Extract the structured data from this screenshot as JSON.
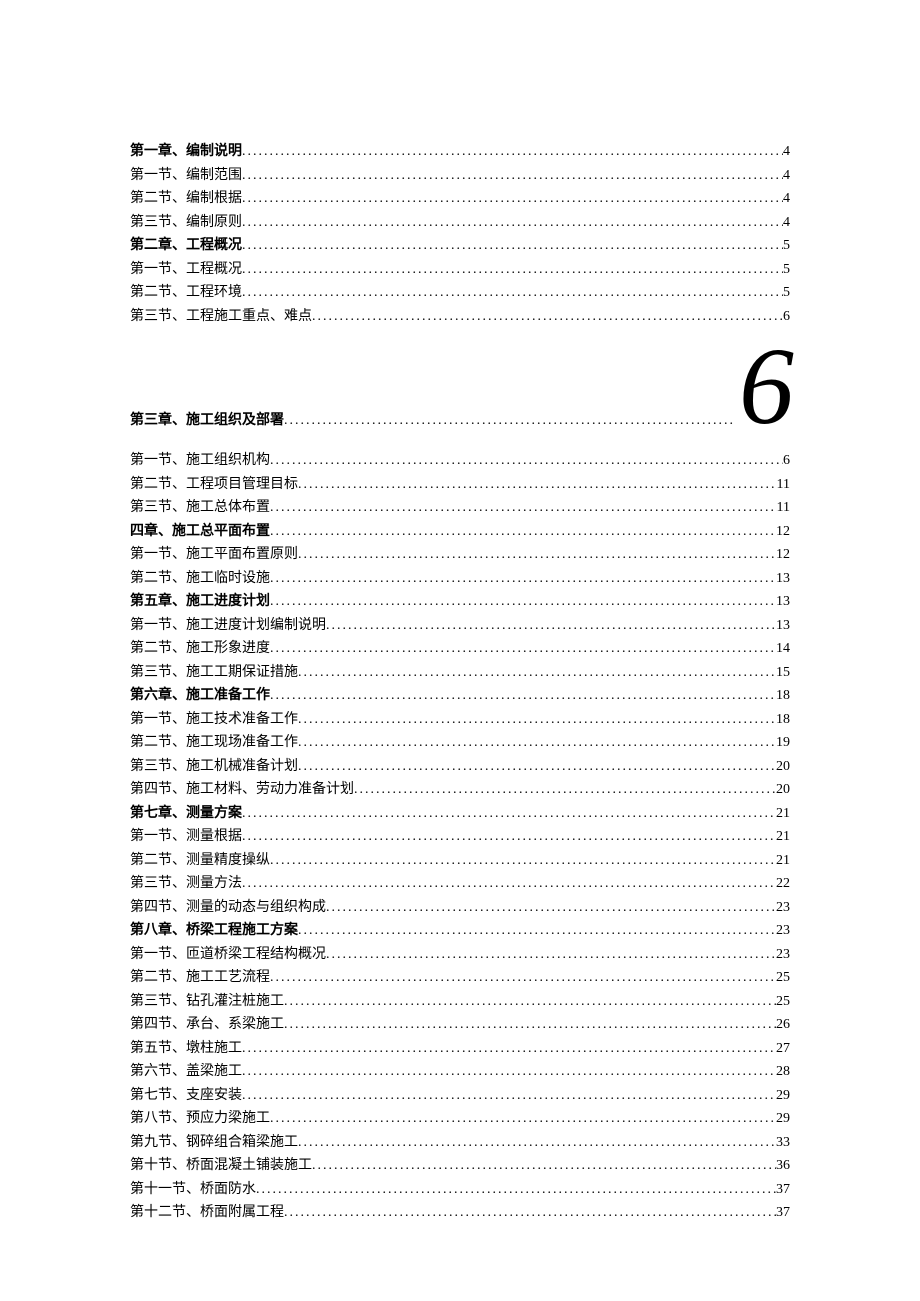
{
  "toc": [
    {
      "label": "第一章、编制说明",
      "page": "4",
      "bold": true
    },
    {
      "label": "第一节、编制范围",
      "page": "4",
      "bold": false
    },
    {
      "label": "第二节、编制根据",
      "page": "4",
      "bold": false
    },
    {
      "label": "第三节、编制原则",
      "page": "4",
      "bold": false
    },
    {
      "label": "第二章、工程概况",
      "page": "5",
      "bold": true
    },
    {
      "label": "第一节、工程概况",
      "page": "5",
      "bold": false
    },
    {
      "label": "第二节、工程环境",
      "page": "5",
      "bold": false
    },
    {
      "label": "第三节、工程施工重点、难点",
      "page": "6",
      "bold": false
    }
  ],
  "bigSixRow": {
    "label": "第三章、施工组织及部署",
    "page": "6"
  },
  "toc2": [
    {
      "label": "第一节、施工组织机构",
      "page": "6",
      "bold": false
    },
    {
      "label": "第二节、工程项目管理目标",
      "page": "11",
      "bold": false
    },
    {
      "label": "第三节、施工总体布置",
      "page": "11",
      "bold": false
    },
    {
      "label": "四章、施工总平面布置",
      "page": "12",
      "bold": true
    },
    {
      "label": "第一节、施工平面布置原则",
      "page": "12",
      "bold": false
    },
    {
      "label": "第二节、施工临时设施",
      "page": "13",
      "bold": false
    },
    {
      "label": "第五章、施工进度计划",
      "page": "13",
      "bold": true
    },
    {
      "label": "第一节、施工进度计划编制说明",
      "page": "13",
      "bold": false
    },
    {
      "label": "第二节、施工形象进度",
      "page": "14",
      "bold": false
    },
    {
      "label": "第三节、施工工期保证措施",
      "page": "15",
      "bold": false
    },
    {
      "label": "第六章、施工准备工作",
      "page": "18",
      "bold": true
    },
    {
      "label": "第一节、施工技术准备工作",
      "page": "18",
      "bold": false
    },
    {
      "label": "第二节、施工现场准备工作",
      "page": "19",
      "bold": false
    },
    {
      "label": "第三节、施工机械准备计划",
      "page": "20",
      "bold": false
    },
    {
      "label": "第四节、施工材料、劳动力准备计划",
      "page": "20",
      "bold": false
    },
    {
      "label": "第七章、测量方案",
      "page": "21",
      "bold": true
    },
    {
      "label": "第一节、测量根据",
      "page": "21",
      "bold": false
    },
    {
      "label": "第二节、测量精度操纵",
      "page": "21",
      "bold": false
    },
    {
      "label": "第三节、测量方法",
      "page": "22",
      "bold": false
    },
    {
      "label": "第四节、测量的动态与组织构成",
      "page": "23",
      "bold": false
    },
    {
      "label": "第八章、桥梁工程施工方案",
      "page": "23",
      "bold": true
    },
    {
      "label": "第一节、匝道桥梁工程结构概况",
      "page": "23",
      "bold": false
    },
    {
      "label": "第二节、施工工艺流程",
      "page": "25",
      "bold": false
    },
    {
      "label": "第三节、钻孔灌注桩施工",
      "page": "25",
      "bold": false
    },
    {
      "label": "第四节、承台、系梁施工",
      "page": "26",
      "bold": false
    },
    {
      "label": "第五节、墩柱施工",
      "page": "27",
      "bold": false
    },
    {
      "label": "第六节、盖梁施工",
      "page": "28",
      "bold": false
    },
    {
      "label": "第七节、支座安装",
      "page": "29",
      "bold": false
    },
    {
      "label": "第八节、预应力梁施工",
      "page": "29",
      "bold": false
    },
    {
      "label": "第九节、钢碎组合箱梁施工",
      "page": "33",
      "bold": false
    },
    {
      "label": "第十节、桥面混凝土铺装施工",
      "page": "36",
      "bold": false
    },
    {
      "label": "第十一节、桥面防水",
      "page": "37",
      "bold": false
    },
    {
      "label": "第十二节、桥面附属工程",
      "page": "37",
      "bold": false
    }
  ]
}
